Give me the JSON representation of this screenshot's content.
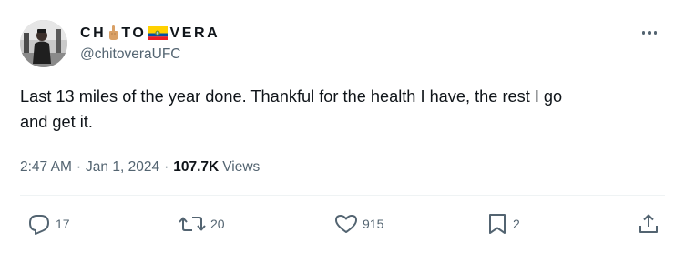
{
  "user": {
    "display_name_part1": "CH",
    "display_name_part2": "TO",
    "display_name_part3": "VERA",
    "emoji_1": "middle-finger-emoji-icon",
    "emoji_2": "ecuador-flag-icon",
    "handle": "@chitoveraUFC"
  },
  "tweet": {
    "text": "Last 13 miles of the year done. Thankful for the health I have, the rest I go\nand get it.",
    "time": "2:47 AM",
    "date": "Jan 1, 2024",
    "separator": "·",
    "views_count": "107.7K",
    "views_label": "Views"
  },
  "actions": {
    "replies": "17",
    "reposts": "20",
    "likes": "915",
    "bookmarks": "2"
  },
  "colors": {
    "text": "#0f1419",
    "secondary": "#536471",
    "divider": "#eff3f4"
  }
}
